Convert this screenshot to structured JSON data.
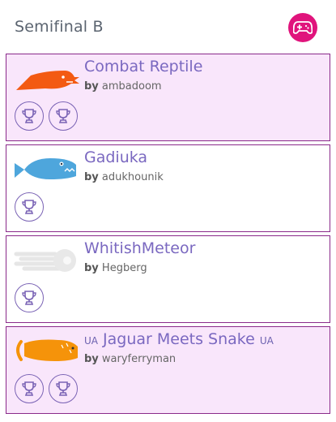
{
  "header": {
    "title": "Semifinal B",
    "game_icon": "gamepad-icon",
    "game_color": "#e0147c"
  },
  "accent_colors": {
    "highlight_bg": "#f9e6fb",
    "name_text": "#7a68c0",
    "border": "#8a2a8a"
  },
  "entries": [
    {
      "name": "Combat Reptile",
      "by": "by",
      "owner": "ambadoom",
      "trophies": 2,
      "highlighted": true,
      "icon": "reptile-bot-icon"
    },
    {
      "name": "Gadiuka",
      "by": "by",
      "owner": "adukhounik",
      "trophies": 1,
      "highlighted": false,
      "icon": "fish-bot-icon"
    },
    {
      "name": "WhitishMeteor",
      "by": "by",
      "owner": "Hegberg",
      "trophies": 1,
      "highlighted": false,
      "icon": "meteor-bot-icon"
    },
    {
      "name": "Jaguar Meets Snake",
      "flag_left": "UA",
      "flag_right": "UA",
      "by": "by",
      "owner": "waryferryman",
      "trophies": 2,
      "highlighted": true,
      "icon": "jaguar-bot-icon"
    }
  ]
}
